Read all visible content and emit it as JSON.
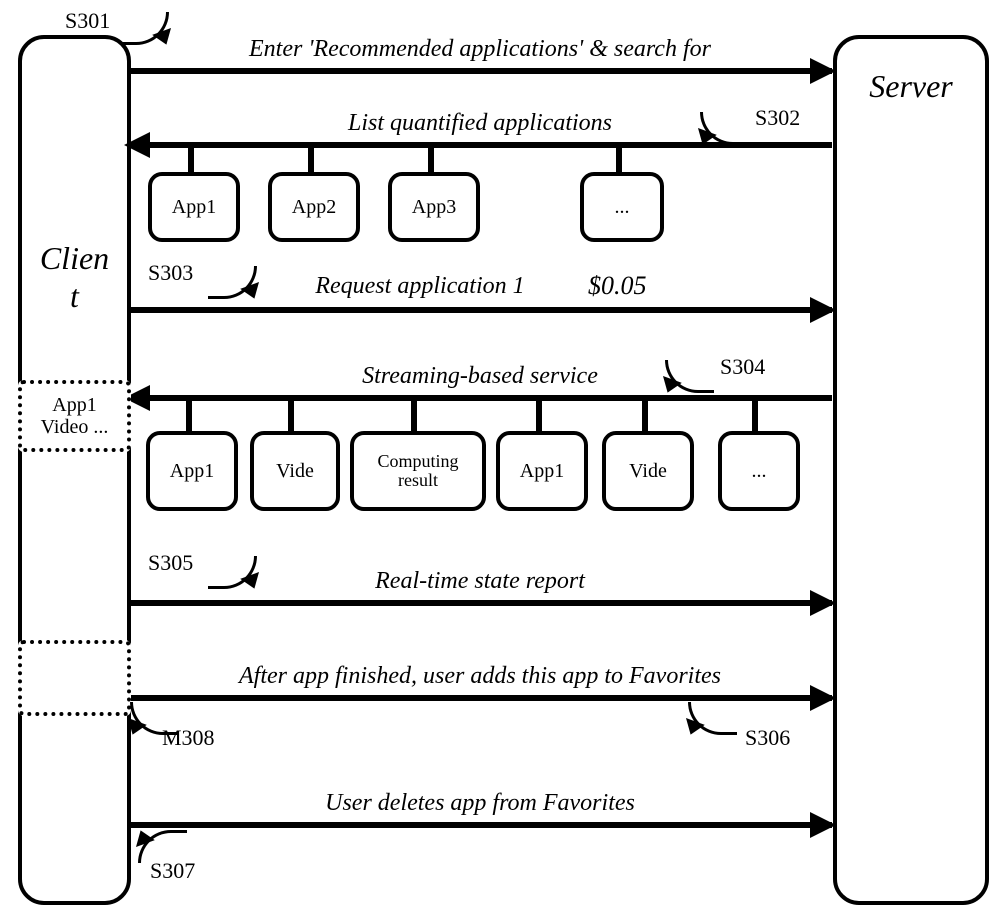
{
  "actors": {
    "client": "Clien\nt",
    "server": "Server"
  },
  "steps": {
    "s301": {
      "tag": "S301",
      "label": "Enter 'Recommended applications' & search for"
    },
    "s302": {
      "tag": "S302",
      "label": "List quantified applications",
      "items": [
        "App1",
        "App2",
        "App3",
        "..."
      ]
    },
    "s303": {
      "tag": "S303",
      "label": "Request application 1",
      "price": "$0.05"
    },
    "s304": {
      "tag": "S304",
      "label": "Streaming-based service",
      "items": [
        "App1",
        "Vide",
        "Computing result",
        "App1",
        "Vide",
        "..."
      ],
      "client_preview": "App1\nVideo ..."
    },
    "s305": {
      "tag": "S305",
      "label": "Real-time state report"
    },
    "s306": {
      "tag": "S306",
      "label": "After app finished, user adds this app to Favorites"
    },
    "s307": {
      "tag": "S307",
      "label": "User deletes app from Favorites"
    },
    "m308": {
      "tag": "M308"
    }
  }
}
